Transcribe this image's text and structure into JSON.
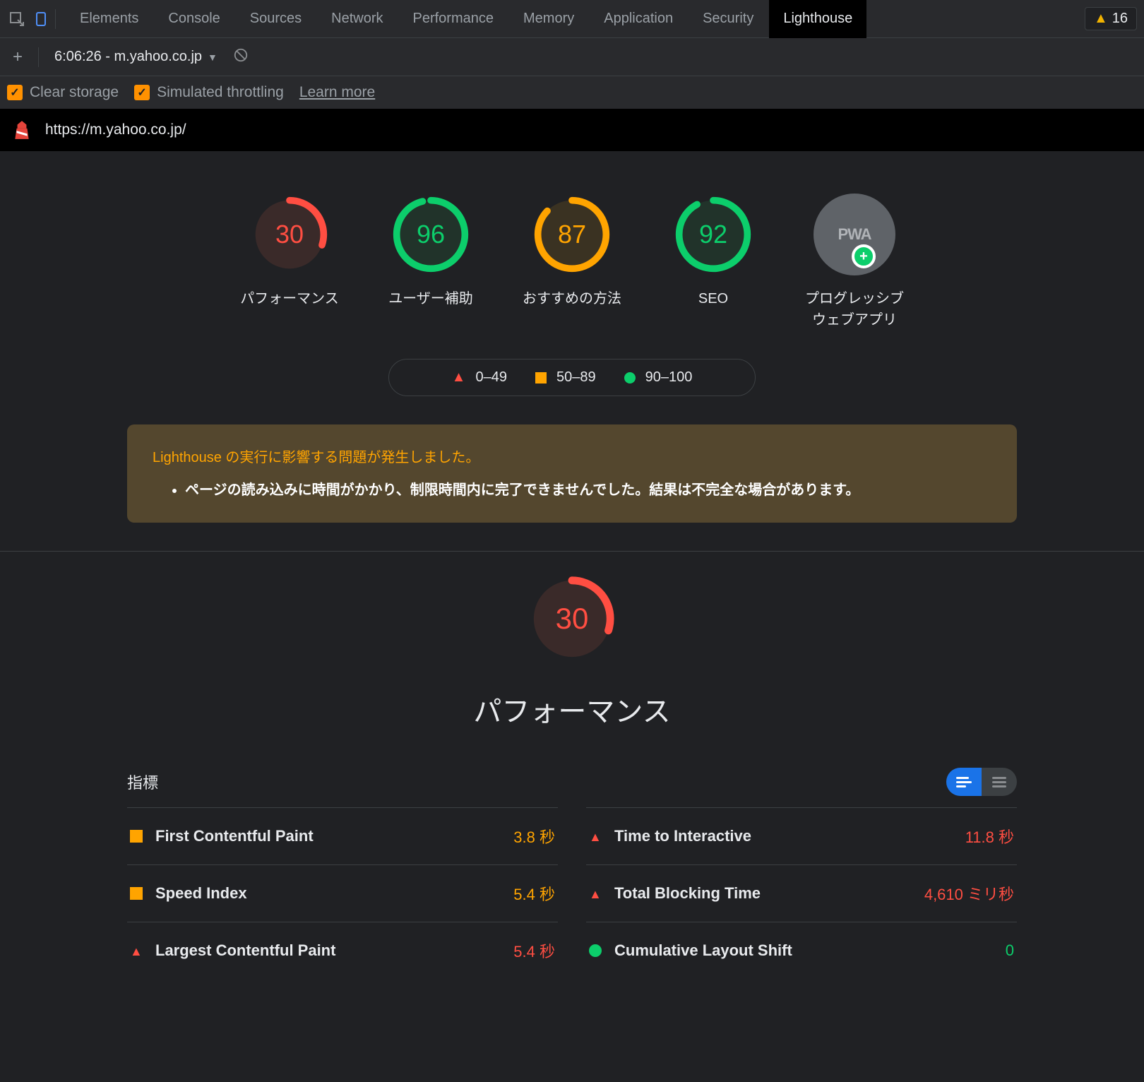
{
  "devtools": {
    "tabs": [
      "Elements",
      "Console",
      "Sources",
      "Network",
      "Performance",
      "Memory",
      "Application",
      "Security",
      "Lighthouse"
    ],
    "active_tab": "Lighthouse",
    "warning_count": "16"
  },
  "toolbar": {
    "report_name": "6:06:26 - m.yahoo.co.jp"
  },
  "options": {
    "clear_storage_label": "Clear storage",
    "simulated_throttling_label": "Simulated throttling",
    "learn_more": "Learn more"
  },
  "url_bar": {
    "url": "https://m.yahoo.co.jp/"
  },
  "gauges": [
    {
      "value": 30,
      "label": "パフォーマンス",
      "color": "#ff4e42",
      "bg": "#3a2a29"
    },
    {
      "value": 96,
      "label": "ユーザー補助",
      "color": "#0cce6b",
      "bg": "#21332a"
    },
    {
      "value": 87,
      "label": "おすすめの方法",
      "color": "#ffa400",
      "bg": "#3a3222"
    },
    {
      "value": 92,
      "label": "SEO",
      "color": "#0cce6b",
      "bg": "#21332a"
    }
  ],
  "pwa_label": "プログレッシブ ウェブアプリ",
  "pwa_text": "PWA",
  "legend": {
    "low": "0–49",
    "mid": "50–89",
    "high": "90–100"
  },
  "warning": {
    "title": "Lighthouse の実行に影響する問題が発生しました。",
    "items": [
      "ページの読み込みに時間がかかり、制限時間内に完了できませんでした。結果は不完全な場合があります。"
    ]
  },
  "performance": {
    "gauge": {
      "value": 30,
      "color": "#ff4e42",
      "bg": "#3a2a29"
    },
    "title": "パフォーマンス",
    "metrics_label": "指標",
    "metrics": [
      {
        "name": "First Contentful Paint",
        "value": "3.8 秒",
        "status": "sq",
        "color": "orange"
      },
      {
        "name": "Time to Interactive",
        "value": "11.8 秒",
        "status": "tri",
        "color": "red"
      },
      {
        "name": "Speed Index",
        "value": "5.4 秒",
        "status": "sq",
        "color": "orange"
      },
      {
        "name": "Total Blocking Time",
        "value": "4,610 ミリ秒",
        "status": "tri",
        "color": "red"
      },
      {
        "name": "Largest Contentful Paint",
        "value": "5.4 秒",
        "status": "tri",
        "color": "red"
      },
      {
        "name": "Cumulative Layout Shift",
        "value": "0",
        "status": "circ",
        "color": "green"
      }
    ]
  }
}
